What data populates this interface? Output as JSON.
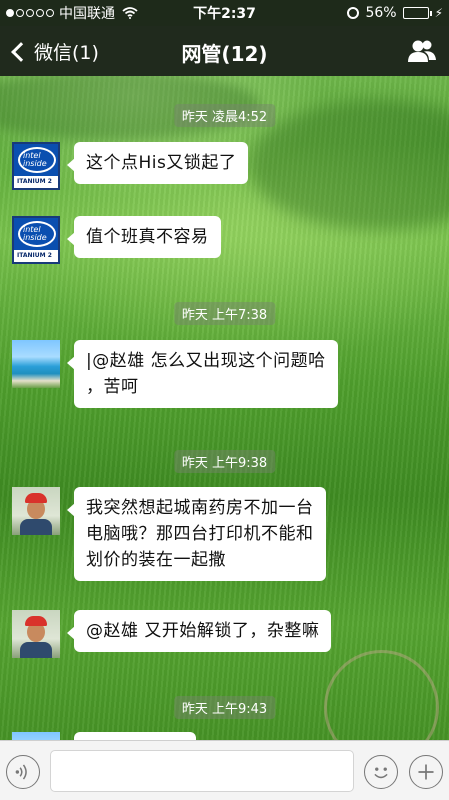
{
  "status_bar": {
    "signal_dots": 5,
    "signal_filled": 1,
    "carrier": "中国联通",
    "time": "下午2:37",
    "battery_percent": "56%",
    "battery_level": 0.56
  },
  "nav": {
    "back_label": "微信(1)",
    "title": "网管(12)"
  },
  "messages": [
    {
      "type": "timestamp",
      "text": "昨天 凌晨4:52"
    },
    {
      "type": "message",
      "avatar": "intel-itanium-avatar",
      "text": "这个点His又锁起了"
    },
    {
      "type": "message",
      "avatar": "intel-itanium-avatar",
      "text": "值个班真不容易"
    },
    {
      "type": "timestamp",
      "text": "昨天 上午7:38"
    },
    {
      "type": "message",
      "avatar": "beach-avatar",
      "text": "|@赵雄 怎么又出现这个问题哈\n，苦呵"
    },
    {
      "type": "timestamp",
      "text": "昨天 上午9:38"
    },
    {
      "type": "message",
      "avatar": "person-avatar",
      "text": "我突然想起城南药房不加一台\n电脑哦？那四台打印机不能和\n划价的装在一起撒"
    },
    {
      "type": "message",
      "avatar": "person-avatar",
      "text": "@赵雄 又开始解锁了，杂整嘛"
    },
    {
      "type": "timestamp",
      "text": "昨天 上午9:43"
    }
  ],
  "input_bar": {
    "placeholder": ""
  },
  "colors": {
    "bar_bg": "#202a1d",
    "bubble_bg": "#ffffff",
    "battery_fill": "#4cd964"
  }
}
